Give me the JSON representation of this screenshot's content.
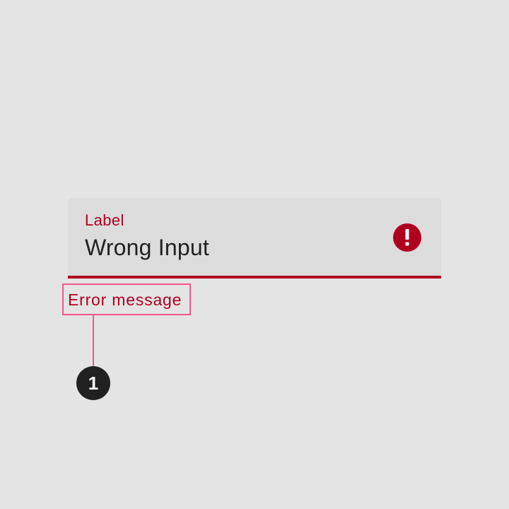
{
  "text_field": {
    "label": "Label",
    "value": "Wrong Input",
    "state": "error",
    "trailing_icon": "error-exclamation-icon"
  },
  "helper": {
    "error_text": "Error message"
  },
  "annotation": {
    "number": "1"
  },
  "colors": {
    "background": "#e4e4e4",
    "field_fill": "#dcdcdc",
    "error": "#b00020",
    "annotation_outline": "#f2578a",
    "marker": "#212121",
    "input_text": "#212121"
  }
}
